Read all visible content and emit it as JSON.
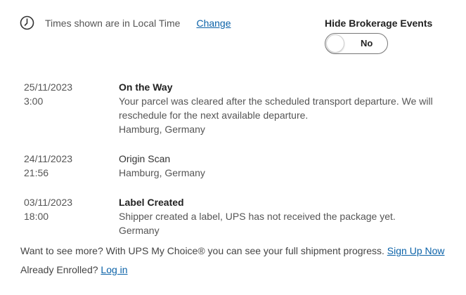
{
  "timezone": {
    "icon": "clock-icon",
    "text": "Times shown are in Local Time",
    "change_link": "Change"
  },
  "brokerage": {
    "label": "Hide Brokerage Events",
    "toggle_value": "No"
  },
  "events": [
    {
      "date": "25/11/2023",
      "time": "3:00",
      "status": "On the Way",
      "status_bold": true,
      "description_lines": [
        "Your parcel was cleared after the scheduled transport departure. We will",
        "reschedule for the next available departure."
      ],
      "location": "Hamburg, Germany"
    },
    {
      "date": "24/11/2023",
      "time": "21:56",
      "status": "Origin Scan",
      "status_bold": false,
      "description_lines": [],
      "location": "Hamburg, Germany"
    },
    {
      "date": "03/11/2023",
      "time": "18:00",
      "status": "Label Created",
      "status_bold": true,
      "description_lines": [
        "Shipper created a label, UPS has not received the package yet."
      ],
      "location": "Germany"
    }
  ],
  "promo": {
    "text": "Want to see more? With UPS My Choice® you can see your full shipment progress.",
    "signup_link": "Sign Up Now",
    "enrolled_text": "Already Enrolled?",
    "login_link": "Log in"
  },
  "colors": {
    "link": "#0b62a8",
    "text": "#555555",
    "heading": "#222222"
  }
}
